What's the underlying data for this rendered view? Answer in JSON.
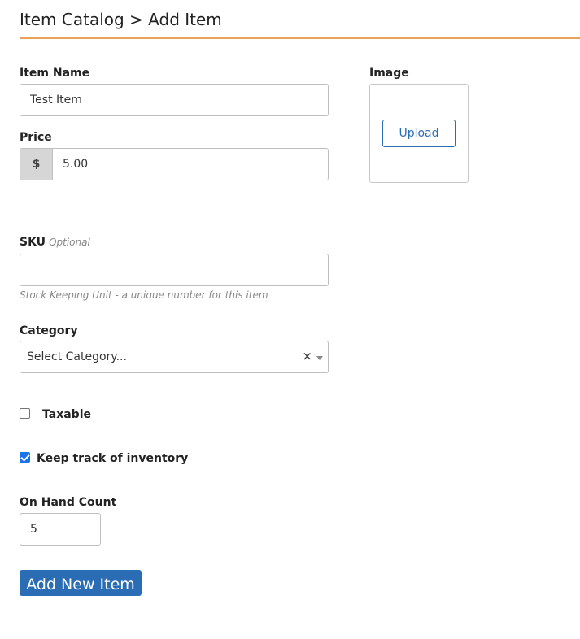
{
  "header": {
    "breadcrumb": "Item Catalog > Add Item"
  },
  "form": {
    "item_name": {
      "label": "Item Name",
      "value": "Test Item"
    },
    "price": {
      "label": "Price",
      "currency_symbol": "$",
      "value": "5.00"
    },
    "image": {
      "label": "Image",
      "upload_label": "Upload"
    },
    "sku": {
      "label": "SKU",
      "optional_tag": "Optional",
      "value": "",
      "help": "Stock Keeping Unit - a unique number for this item"
    },
    "category": {
      "label": "Category",
      "selected": "Select Category...",
      "clear_symbol": "×"
    },
    "taxable": {
      "label": "Taxable",
      "checked": false
    },
    "track_inventory": {
      "label": "Keep track of inventory",
      "checked": true
    },
    "on_hand": {
      "label": "On Hand Count",
      "value": "5"
    },
    "submit_label": "Add New Item"
  },
  "colors": {
    "accent_rule": "#e8a25a",
    "primary": "#2a6db5",
    "checkbox_checked": "#1a73e8"
  }
}
